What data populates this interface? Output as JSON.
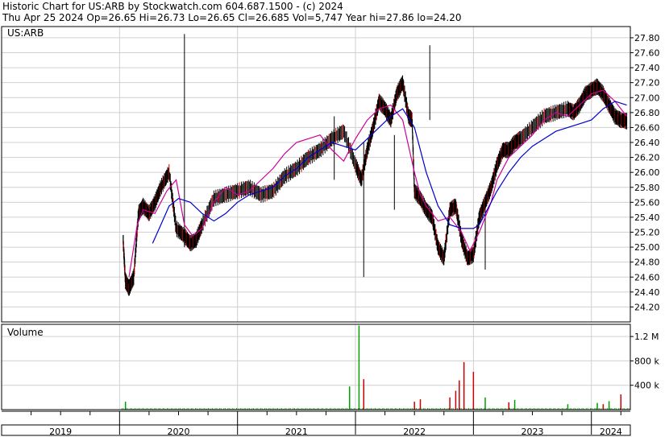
{
  "header": {
    "line1": "Historic Chart for US:ARB by Stockwatch.com 604.687.1500 - (c) 2024",
    "line2": "Thu Apr 25 2024   Op=26.65   Hi=26.73   Lo=26.65   Cl=26.685   Vol=5,747   Year hi=27.86   lo=24.20"
  },
  "chart_data": [
    {
      "type": "line",
      "title": "US:ARB",
      "subtype": "price-bars-with-moving-averages",
      "ylim": [
        24.0,
        27.95
      ],
      "y_ticks": [
        "24.20",
        "24.40",
        "24.60",
        "24.80",
        "25.00",
        "25.20",
        "25.40",
        "25.60",
        "25.80",
        "26.00",
        "26.20",
        "26.40",
        "26.60",
        "26.80",
        "27.00",
        "27.20",
        "27.40",
        "27.60",
        "27.80"
      ],
      "x_ticks": [
        "2019",
        "2020",
        "2021",
        "2022",
        "2023",
        "2024"
      ],
      "x_range": [
        2019.0,
        2024.33
      ],
      "grid": true,
      "series": [
        {
          "role": "close",
          "color": "#000000",
          "x": [
            2020.03,
            2020.05,
            2020.08,
            2020.12,
            2020.16,
            2020.2,
            2020.25,
            2020.3,
            2020.35,
            2020.42,
            2020.48,
            2020.55,
            2020.6,
            2020.65,
            2020.7,
            2020.8,
            2020.9,
            2021.0,
            2021.1,
            2021.2,
            2021.3,
            2021.4,
            2021.5,
            2021.6,
            2021.7,
            2021.8,
            2021.9,
            2022.0,
            2022.05,
            2022.1,
            2022.15,
            2022.2,
            2022.25,
            2022.3,
            2022.35,
            2022.4,
            2022.45,
            2022.48,
            2022.5,
            2022.55,
            2022.6,
            2022.65,
            2022.7,
            2022.75,
            2022.8,
            2022.85,
            2022.9,
            2022.95,
            2023.0,
            2023.05,
            2023.1,
            2023.15,
            2023.2,
            2023.25,
            2023.3,
            2023.35,
            2023.4,
            2023.5,
            2023.6,
            2023.7,
            2023.8,
            2023.85,
            2023.9,
            2023.95,
            2024.0,
            2024.05,
            2024.1,
            2024.15,
            2024.2,
            2024.25,
            2024.3
          ],
          "values": [
            25.1,
            24.55,
            24.45,
            24.6,
            25.45,
            25.55,
            25.45,
            25.6,
            25.8,
            26.0,
            25.25,
            25.15,
            25.05,
            25.1,
            25.3,
            25.65,
            25.7,
            25.75,
            25.8,
            25.7,
            25.75,
            25.95,
            26.05,
            26.2,
            26.3,
            26.45,
            26.55,
            26.1,
            25.9,
            26.3,
            26.6,
            26.95,
            26.85,
            26.7,
            27.05,
            27.2,
            26.75,
            26.7,
            25.75,
            25.65,
            25.5,
            25.4,
            25.0,
            24.85,
            25.5,
            25.55,
            25.1,
            24.85,
            24.9,
            25.4,
            25.6,
            25.8,
            26.1,
            26.3,
            26.3,
            26.4,
            26.45,
            26.6,
            26.75,
            26.8,
            26.85,
            26.8,
            26.9,
            27.05,
            27.1,
            27.15,
            27.05,
            26.9,
            26.75,
            26.7,
            26.685
          ]
        },
        {
          "role": "short-moving-average",
          "color": "#cc0099",
          "x": [
            2020.08,
            2020.15,
            2020.2,
            2020.3,
            2020.4,
            2020.48,
            2020.55,
            2020.62,
            2020.7,
            2020.8,
            2020.9,
            2021.0,
            2021.1,
            2021.2,
            2021.3,
            2021.4,
            2021.5,
            2021.6,
            2021.7,
            2021.8,
            2021.9,
            2022.0,
            2022.1,
            2022.2,
            2022.3,
            2022.4,
            2022.5,
            2022.55,
            2022.6,
            2022.7,
            2022.8,
            2022.9,
            2022.97,
            2023.05,
            2023.15,
            2023.2,
            2023.3,
            2023.4,
            2023.5,
            2023.6,
            2023.7,
            2023.8,
            2023.9,
            2024.0,
            2024.1,
            2024.2,
            2024.3
          ],
          "values": [
            24.6,
            25.3,
            25.5,
            25.45,
            25.75,
            25.9,
            25.3,
            25.15,
            25.25,
            25.6,
            25.8,
            25.7,
            25.75,
            25.9,
            26.05,
            26.25,
            26.4,
            26.45,
            26.5,
            26.3,
            26.15,
            26.45,
            26.7,
            26.85,
            26.9,
            26.7,
            26.0,
            25.7,
            25.55,
            25.35,
            25.4,
            25.2,
            24.95,
            25.2,
            25.6,
            25.9,
            26.2,
            26.35,
            26.5,
            26.7,
            26.8,
            26.75,
            26.9,
            27.05,
            27.1,
            26.95,
            26.75
          ]
        },
        {
          "role": "long-moving-average",
          "color": "#0000cc",
          "x": [
            2020.28,
            2020.35,
            2020.42,
            2020.5,
            2020.6,
            2020.7,
            2020.8,
            2020.9,
            2021.0,
            2021.1,
            2021.2,
            2021.3,
            2021.4,
            2021.5,
            2021.6,
            2021.7,
            2021.8,
            2021.9,
            2022.0,
            2022.1,
            2022.2,
            2022.3,
            2022.4,
            2022.5,
            2022.55,
            2022.6,
            2022.7,
            2022.8,
            2022.9,
            2023.0,
            2023.05,
            2023.1,
            2023.2,
            2023.3,
            2023.4,
            2023.5,
            2023.6,
            2023.7,
            2023.8,
            2023.9,
            2024.0,
            2024.1,
            2024.2,
            2024.3
          ],
          "values": [
            25.05,
            25.3,
            25.55,
            25.65,
            25.6,
            25.45,
            25.35,
            25.45,
            25.6,
            25.7,
            25.75,
            25.8,
            25.95,
            26.05,
            26.2,
            26.3,
            26.4,
            26.35,
            26.3,
            26.45,
            26.6,
            26.75,
            26.85,
            26.6,
            26.3,
            26.0,
            25.55,
            25.3,
            25.25,
            25.25,
            25.3,
            25.45,
            25.75,
            26.0,
            26.2,
            26.35,
            26.45,
            26.55,
            26.6,
            26.65,
            26.7,
            26.85,
            26.95,
            26.9
          ]
        }
      ]
    },
    {
      "type": "bar",
      "title": "Volume",
      "y_ticks": [
        "400 k",
        "800 k",
        "1.2 M"
      ],
      "ylim": [
        0,
        1400000
      ],
      "series": [
        {
          "name": "up",
          "color": "#00a000",
          "x": [
            2020.05,
            2021.95,
            2022.03,
            2023.1,
            2023.35,
            2023.8,
            2024.05,
            2024.15
          ],
          "values": [
            130000,
            380000,
            1380000,
            200000,
            160000,
            90000,
            110000,
            140000
          ]
        },
        {
          "name": "down",
          "color": "#cc0000",
          "x": [
            2022.07,
            2022.5,
            2022.55,
            2022.8,
            2022.85,
            2022.88,
            2022.92,
            2023.0,
            2023.3,
            2024.1,
            2024.25
          ],
          "values": [
            500000,
            130000,
            170000,
            200000,
            310000,
            480000,
            780000,
            620000,
            120000,
            90000,
            250000
          ]
        }
      ]
    }
  ]
}
